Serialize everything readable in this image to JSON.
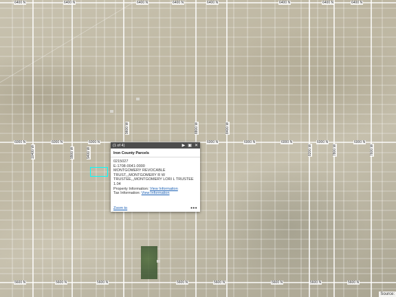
{
  "map": {
    "road_labels_horizontal_top": [
      "6400 N",
      "6400 N",
      "6400 N",
      "6400 N",
      "6400 N",
      "6400 N",
      "6400 N",
      "6400 N"
    ],
    "road_labels_horizontal_mid": [
      "6000 N",
      "6000 N",
      "6000 N",
      "6000 N",
      "6000 N",
      "6000 N",
      "6000 N",
      "6000 N"
    ],
    "road_labels_horizontal_bottom": [
      "5600 N",
      "5600 N",
      "5600 N",
      "5600 N",
      "5600 N",
      "5600 N",
      "5600 N",
      "5600 N"
    ],
    "road_labels_vertical": [
      "10400 W",
      "9900 W",
      "9400 W",
      "9600 W",
      "8800 W",
      "8400 W",
      "8200 W",
      "7800 W",
      "7600 W"
    ],
    "colors": {
      "selection": "#00ffff",
      "popup_header": "#4c4c4c",
      "link": "#1a5fb4"
    }
  },
  "popup": {
    "pager": "(1 of 4)",
    "title": "Iron County Parcels",
    "lines": [
      "0215027",
      "E-1708-0041-0000",
      "MONTGOMERY REVOCABLE",
      "TRUST,,,MONTGOMERY R W",
      "TRUSTEE,,,MONTGOMERY LORI L TRUSTEE",
      "1.04"
    ],
    "property_label": "Property Information:",
    "property_link": "View Information",
    "tax_label": "Tax Information:",
    "tax_link": "View Information",
    "zoom_to": "Zoom to",
    "more": "•••",
    "icons": {
      "next": "next-icon",
      "maximize": "maximize-icon",
      "close": "close-icon"
    }
  },
  "source": "Source:"
}
